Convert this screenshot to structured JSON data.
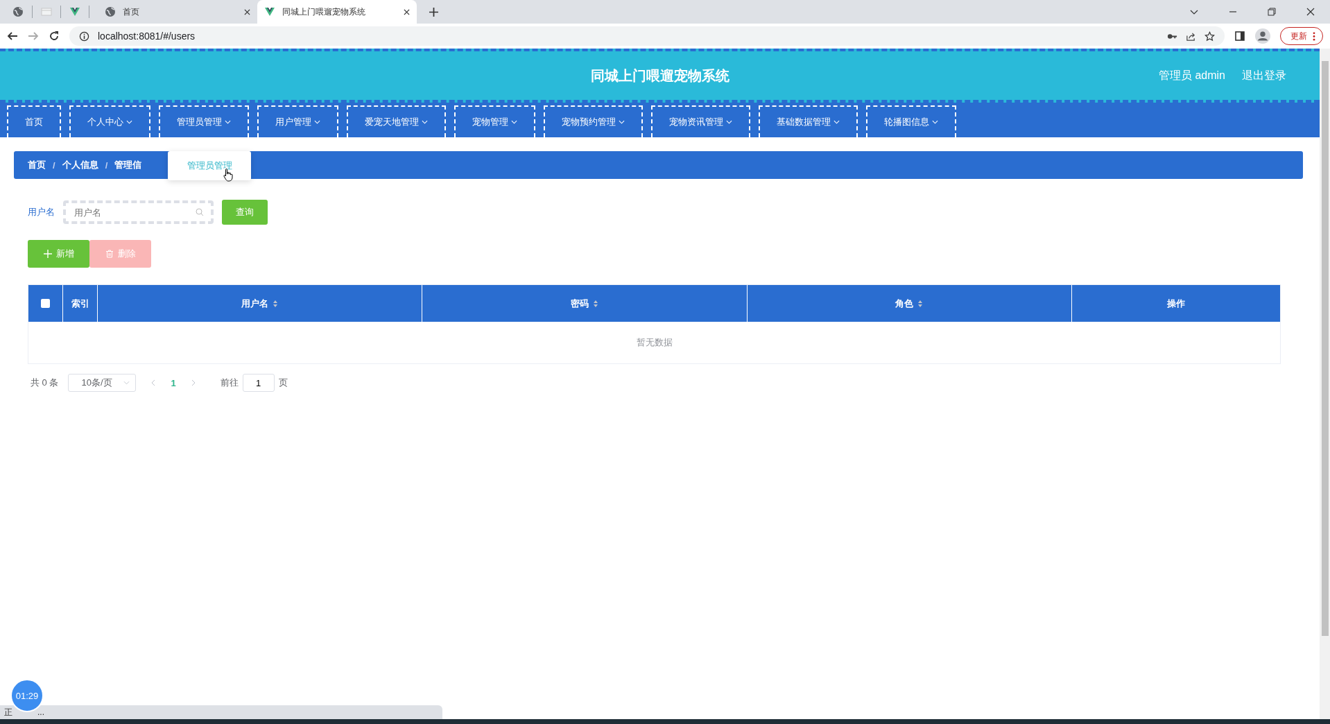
{
  "browser": {
    "tabs": [
      {
        "label": "首页",
        "selected": false
      },
      {
        "label": "同城上门喂遛宠物系统",
        "selected": true
      }
    ],
    "url": "localhost:8081/#/users",
    "update_button": "更新"
  },
  "header": {
    "title": "同城上门喂遛宠物系统",
    "user": "管理员 admin",
    "logout": "退出登录"
  },
  "nav": [
    {
      "label": "首页",
      "dropdown": false
    },
    {
      "label": "个人中心",
      "dropdown": true
    },
    {
      "label": "管理员管理",
      "dropdown": true
    },
    {
      "label": "用户管理",
      "dropdown": true
    },
    {
      "label": "爱宠天地管理",
      "dropdown": true
    },
    {
      "label": "宠物管理",
      "dropdown": true
    },
    {
      "label": "宠物预约管理",
      "dropdown": true
    },
    {
      "label": "宠物资讯管理",
      "dropdown": true
    },
    {
      "label": "基础数据管理",
      "dropdown": true
    },
    {
      "label": "轮播图信息",
      "dropdown": true
    }
  ],
  "breadcrumb": [
    "首页",
    "个人信息",
    "管理信"
  ],
  "breadcrumb_separator": "/",
  "dropdown_menu": {
    "items": [
      "管理员管理"
    ]
  },
  "search": {
    "label": "用户名",
    "placeholder": "用户名",
    "button": "查询"
  },
  "actions": [
    {
      "label": "新增",
      "kind": "add",
      "disabled": false
    },
    {
      "label": "删除",
      "kind": "delete",
      "disabled": true
    }
  ],
  "table": {
    "columns": [
      {
        "label": "索引",
        "sortable": false
      },
      {
        "label": "用户名",
        "sortable": true
      },
      {
        "label": "密码",
        "sortable": true
      },
      {
        "label": "角色",
        "sortable": true
      },
      {
        "label": "操作",
        "sortable": false
      }
    ],
    "select_all_checked": false,
    "empty_text": "暂无数据"
  },
  "pagination": {
    "total": "共 0 条",
    "page_size": "10条/页",
    "pages": [
      {
        "label": "1",
        "selected": true
      }
    ],
    "goto_label": "前往",
    "goto_value": "1",
    "goto_suffix": "页"
  },
  "timer": "01:29",
  "status_bar": [
    "正",
    "..."
  ]
}
